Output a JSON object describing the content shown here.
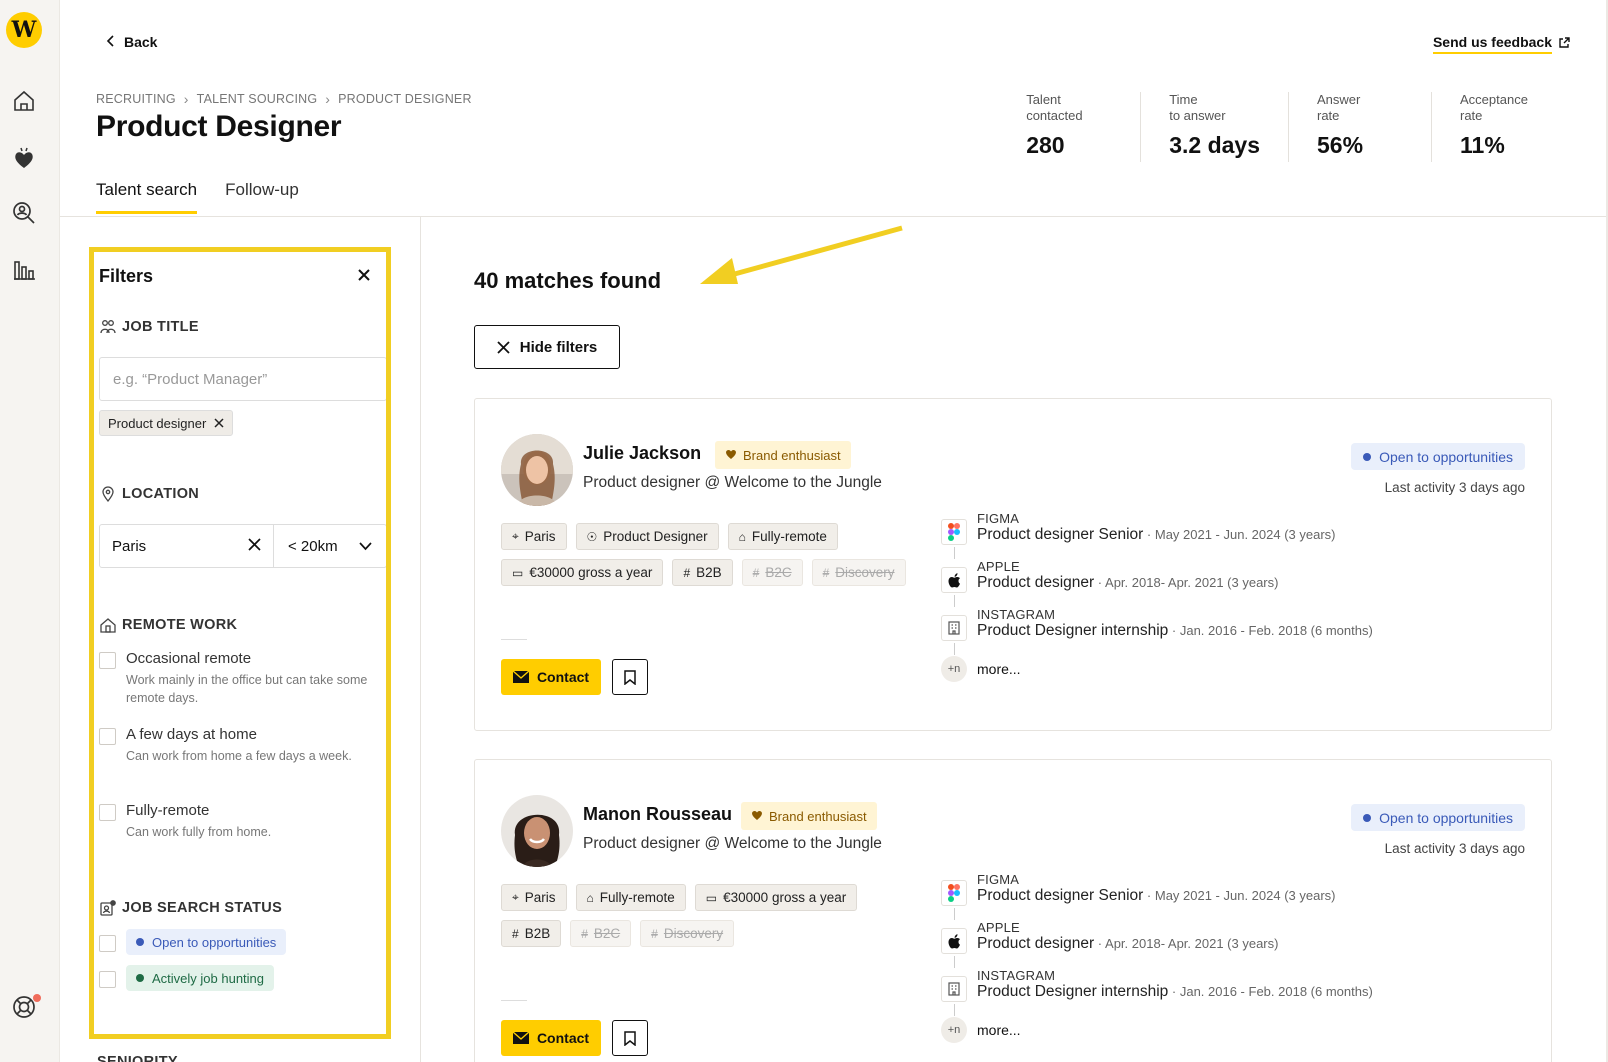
{
  "header": {
    "back_label": "Back",
    "feedback_label": "Send us feedback",
    "breadcrumb": [
      "RECRUITING",
      "TALENT SOURCING",
      "PRODUCT DESIGNER"
    ],
    "title": "Product Designer",
    "tabs": [
      {
        "label": "Talent search",
        "active": true
      },
      {
        "label": "Follow-up",
        "active": false
      }
    ],
    "stats": [
      {
        "label": "Talent\ncontacted",
        "value": "280"
      },
      {
        "label": "Time\nto answer",
        "value": "3.2 days"
      },
      {
        "label": "Answer\nrate",
        "value": "56%"
      },
      {
        "label": "Acceptance\nrate",
        "value": "11%"
      }
    ]
  },
  "sidebar": {
    "logo_text": "W",
    "icons": [
      "home-icon",
      "heart-hand-icon",
      "search-person-icon",
      "stats-icon",
      "help-lifebuoy-icon"
    ],
    "notification_color": "#f06b5a"
  },
  "filters": {
    "title": "Filters",
    "job_title": {
      "label": "JOB TITLE",
      "placeholder": "e.g. “Product Manager”",
      "value": "",
      "chips": [
        "Product designer"
      ]
    },
    "location": {
      "label": "LOCATION",
      "city": "Paris",
      "radius": "< 20km"
    },
    "remote_work": {
      "label": "REMOTE WORK",
      "options": [
        {
          "title": "Occasional remote",
          "desc": "Work mainly in the office but can take some remote days.",
          "checked": false
        },
        {
          "title": "A few days at home",
          "desc": "Can work from home a few days a week.",
          "checked": false
        },
        {
          "title": "Fully-remote",
          "desc": "Can work fully from home.",
          "checked": false
        }
      ]
    },
    "job_search_status": {
      "label": "JOB SEARCH STATUS",
      "options": [
        {
          "label": "Open to opportunities",
          "checked": false
        },
        {
          "label": "Actively job hunting",
          "checked": false
        }
      ]
    },
    "next_section_label": "SENIORITY"
  },
  "results": {
    "count_label": "40 matches found",
    "hide_filters_label": "Hide filters",
    "contact_label": "Contact",
    "candidates": [
      {
        "name": "Julie Jackson",
        "badge": "Brand enthusiast",
        "role": "Product designer @ Welcome to the Jungle",
        "status": "Open to opportunities",
        "last_activity": "Last activity 3 days ago",
        "tags": [
          {
            "icon": "location-icon",
            "label": "Paris",
            "off": false
          },
          {
            "icon": "job-icon",
            "label": "Product Designer",
            "off": false
          },
          {
            "icon": "remote-icon",
            "label": "Fully-remote",
            "off": false
          },
          {
            "icon": "money-icon",
            "label": "€30000 gross a year",
            "off": false
          },
          {
            "icon": "hashtag-icon",
            "label": "B2B",
            "off": false
          },
          {
            "icon": "hashtag-icon",
            "label": "B2C",
            "off": true
          },
          {
            "icon": "hashtag-icon",
            "label": "Discovery",
            "off": true
          }
        ],
        "experience": [
          {
            "company": "FIGMA",
            "title": "Product designer Senior",
            "dates": "May 2021 - Jun. 2024 (3 years)"
          },
          {
            "company": "APPLE",
            "title": "Product designer",
            "dates": "Apr. 2018- Apr. 2021 (3 years)"
          },
          {
            "company": "INSTAGRAM",
            "title": "Product Designer internship",
            "dates": "Jan. 2016 - Feb. 2018 (6 months)"
          }
        ],
        "more_badge": "+n",
        "more_label": "more..."
      },
      {
        "name": "Manon Rousseau",
        "badge": "Brand enthusiast",
        "role": "Product designer @ Welcome to the Jungle",
        "status": "Open to opportunities",
        "last_activity": "Last activity 3 days ago",
        "tags": [
          {
            "icon": "location-icon",
            "label": "Paris",
            "off": false
          },
          {
            "icon": "remote-icon",
            "label": "Fully-remote",
            "off": false
          },
          {
            "icon": "money-icon",
            "label": "€30000 gross a year",
            "off": false
          },
          {
            "icon": "hashtag-icon",
            "label": "B2B",
            "off": false
          },
          {
            "icon": "hashtag-icon",
            "label": "B2C",
            "off": true
          },
          {
            "icon": "hashtag-icon",
            "label": "Discovery",
            "off": true
          }
        ],
        "experience": [
          {
            "company": "FIGMA",
            "title": "Product designer Senior",
            "dates": "May 2021 - Jun. 2024 (3 years)"
          },
          {
            "company": "APPLE",
            "title": "Product designer",
            "dates": "Apr. 2018- Apr. 2021 (3 years)"
          },
          {
            "company": "INSTAGRAM",
            "title": "Product Designer internship",
            "dates": "Jan. 2016 - Feb. 2018 (6 months)"
          }
        ],
        "more_badge": "+n",
        "more_label": "more..."
      }
    ]
  },
  "colors": {
    "accent_yellow": "#ffcd00",
    "highlight_border": "#f1ce22",
    "open_blue": "#3a5ab8",
    "hunting_green": "#1f6b45"
  }
}
